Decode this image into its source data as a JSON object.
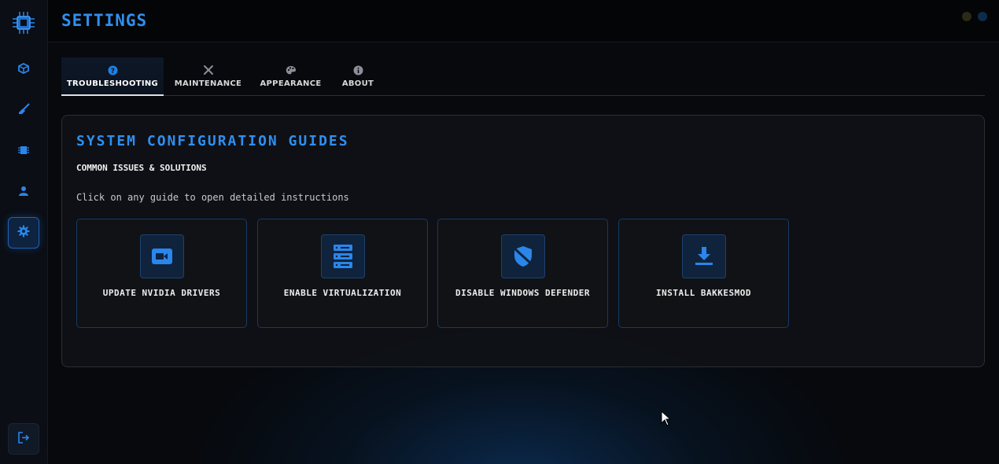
{
  "colors": {
    "accent": "#2f8ff0",
    "icon_blue": "#2a86ea",
    "card_border": "#173a63"
  },
  "sidebar": {
    "logo_icon": "cpu-chip-icon",
    "items": [
      {
        "icon": "cube-icon",
        "active": false
      },
      {
        "icon": "broom-icon",
        "active": false
      },
      {
        "icon": "memory-chip-icon",
        "active": false
      },
      {
        "icon": "user-icon",
        "active": false
      },
      {
        "icon": "gear-icon",
        "active": true
      }
    ],
    "logout_icon": "logout-icon"
  },
  "header": {
    "title": "SETTINGS"
  },
  "tabs": [
    {
      "label": "TROUBLESHOOTING",
      "icon": "question-circle-icon",
      "active": true
    },
    {
      "label": "MAINTENANCE",
      "icon": "tools-icon",
      "active": false
    },
    {
      "label": "APPEARANCE",
      "icon": "palette-icon",
      "active": false
    },
    {
      "label": "ABOUT",
      "icon": "info-circle-icon",
      "active": false
    }
  ],
  "panel": {
    "title": "SYSTEM CONFIGURATION GUIDES",
    "subtitle": "COMMON ISSUES & SOLUTIONS",
    "hint": "Click on any guide to open detailed instructions",
    "cards": [
      {
        "label": "UPDATE NVIDIA DRIVERS",
        "icon": "video-camera-icon"
      },
      {
        "label": "ENABLE VIRTUALIZATION",
        "icon": "server-icon"
      },
      {
        "label": "DISABLE WINDOWS DEFENDER",
        "icon": "shield-slash-icon"
      },
      {
        "label": "INSTALL BAKKESMOD",
        "icon": "download-icon"
      }
    ]
  }
}
